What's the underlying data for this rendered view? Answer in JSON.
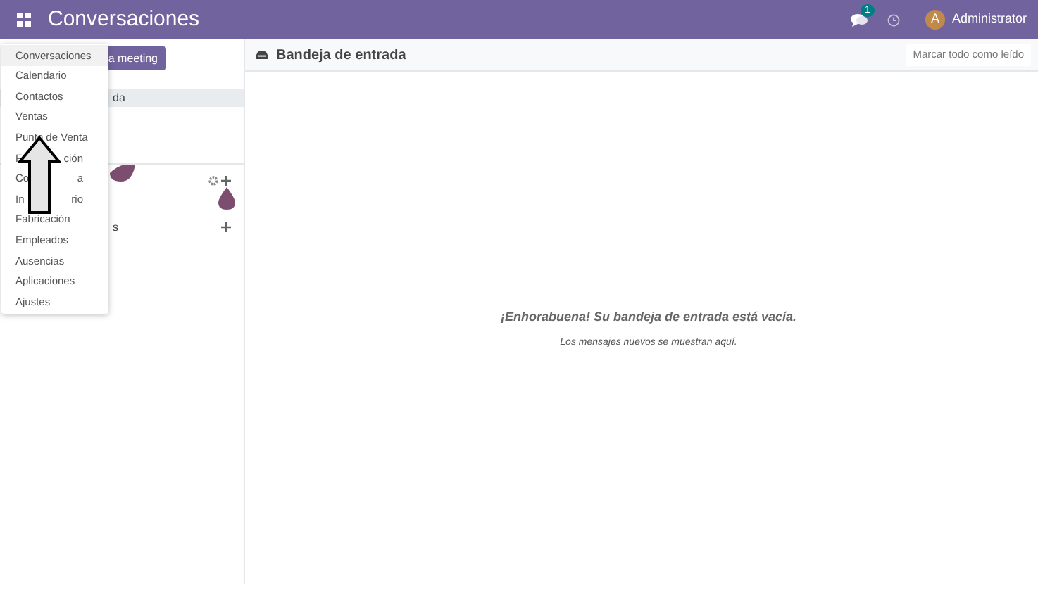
{
  "navbar": {
    "app_title": "Conversaciones",
    "chat_badge": "1",
    "avatar_letter": "A",
    "user": "Administrator"
  },
  "sidebar": {
    "button": "a meeting",
    "items": [
      {
        "label": "da",
        "selected": true
      }
    ],
    "trailing_label": "s"
  },
  "app_menu": {
    "items": [
      {
        "label": "Conversaciones",
        "selected": true
      },
      {
        "label": "Calendario",
        "selected": false
      },
      {
        "label": "Contactos",
        "selected": false
      },
      {
        "label": "Ventas",
        "selected": false
      },
      {
        "label": "Punto de Venta",
        "selected": false
      },
      {
        "label_parts": [
          "F",
          "ción"
        ],
        "selected": false
      },
      {
        "label_parts": [
          "Co",
          "a"
        ],
        "selected": false
      },
      {
        "label_parts": [
          "In",
          "rio"
        ],
        "selected": false
      },
      {
        "label": "Fabricación",
        "selected": false
      },
      {
        "label": "Empleados",
        "selected": false
      },
      {
        "label": "Ausencias",
        "selected": false
      },
      {
        "label": "Aplicaciones",
        "selected": false
      },
      {
        "label": "Ajustes",
        "selected": false
      }
    ]
  },
  "main": {
    "title": "Bandeja de entrada",
    "mark_all_button": "Marcar todo como leído",
    "empty_title": "¡Enhorabuena! Su bandeja de entrada está vacía.",
    "empty_subtitle": "Los mensajes nuevos se muestran aquí."
  }
}
